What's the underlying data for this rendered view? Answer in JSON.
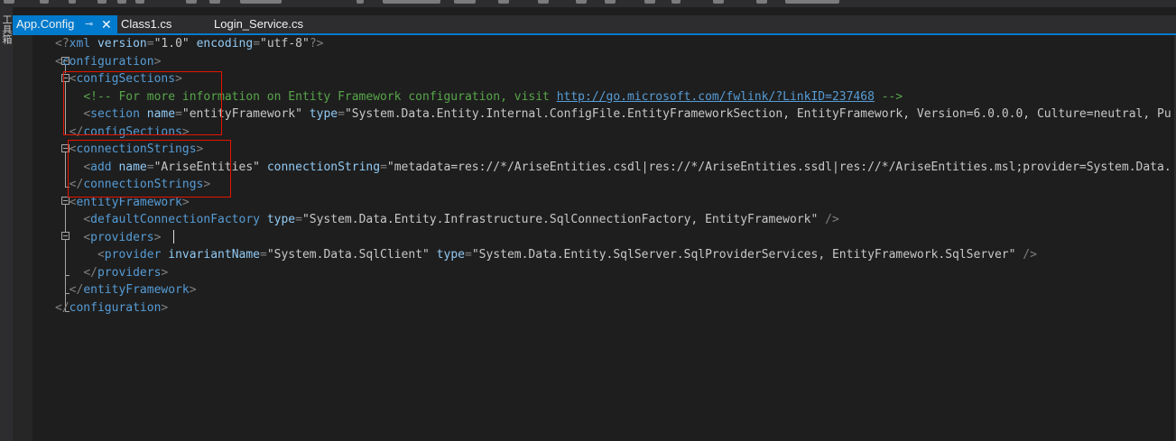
{
  "tabs": [
    {
      "label": "App.Config",
      "active": true
    },
    {
      "label": "Class1.cs",
      "active": false
    },
    {
      "label": "Login_Service.cs",
      "active": false
    }
  ],
  "side_panel_label": "工具箱",
  "colors": {
    "tab_active": "#007acc",
    "background": "#1e1e1e",
    "tag": "#569cd6",
    "attribute": "#92caf4",
    "comment": "#57a64a",
    "highlight_box": "#e51400"
  },
  "code": {
    "decl": {
      "open": "<?",
      "name": "xml",
      "attr1": "version",
      "val1": "\"1.0\"",
      "attr2": "encoding",
      "val2": "\"utf-8\"",
      "close": "?>"
    },
    "configuration": "configuration",
    "configSections": "configSections",
    "comment_text": "<!-- For more information on Entity Framework configuration, visit ",
    "comment_link": "http://go.microsoft.com/fwlink/?LinkID=237468",
    "comment_end": " -->",
    "section": {
      "tag": "section",
      "attr1": "name",
      "val1": "\"entityFramework\"",
      "attr2": "type",
      "val2": "\"System.Data.Entity.Internal.ConfigFile.EntityFrameworkSection, EntityFramework, Version=6.0.0.0, Culture=neutral, Pu"
    },
    "connectionStrings": "connectionStrings",
    "add": {
      "tag": "add",
      "attr1": "name",
      "val1": "\"AriseEntities\"",
      "attr2": "connectionString",
      "val2": "\"metadata=res://*/AriseEntities.csdl|res://*/AriseEntities.ssdl|res://*/AriseEntities.msl;provider=System.Data."
    },
    "entityFramework": "entityFramework",
    "defaultConnectionFactory": {
      "tag": "defaultConnectionFactory",
      "attr1": "type",
      "val1": "\"System.Data.Entity.Infrastructure.SqlConnectionFactory, EntityFramework\""
    },
    "providers": "providers",
    "provider": {
      "tag": "provider",
      "attr1": "invariantName",
      "val1": "\"System.Data.SqlClient\"",
      "attr2": "type",
      "val2": "\"System.Data.Entity.SqlServer.SqlProviderServices, EntityFramework.SqlServer\""
    }
  }
}
